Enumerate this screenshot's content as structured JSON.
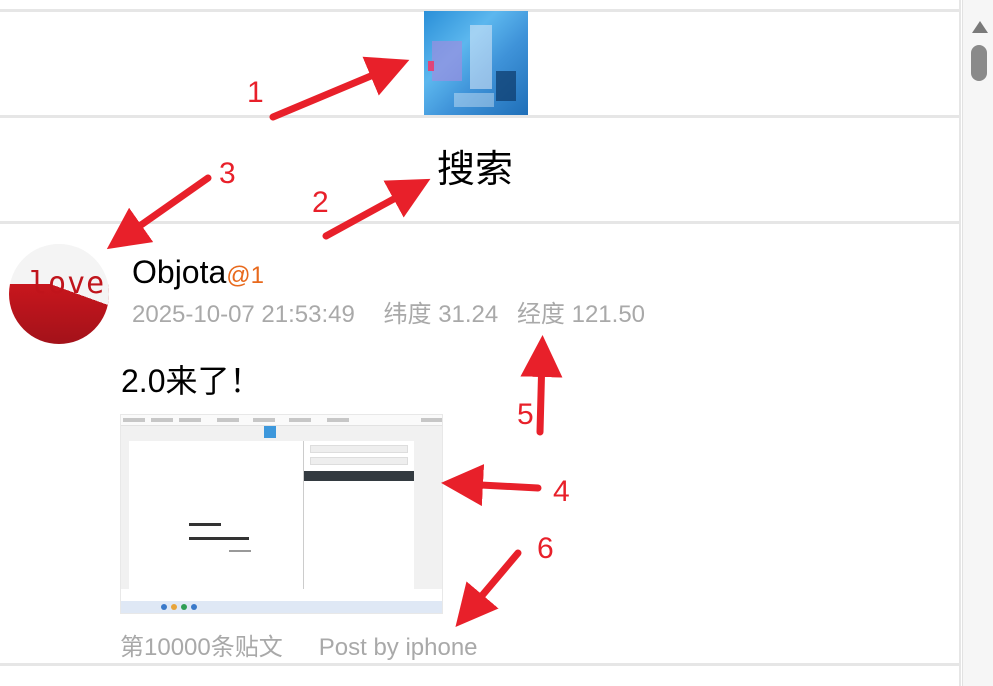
{
  "banner": {
    "image_alt": "blue abstract banner image"
  },
  "search": {
    "title": "搜索"
  },
  "post": {
    "avatar_text": "love",
    "username": "Objota",
    "mention": "@1",
    "timestamp": "2025-10-07 21:53:49",
    "latitude": "纬度 31.24",
    "longitude": "经度 121.50",
    "text": "2.0来了！",
    "post_index": "第10000条贴文",
    "device": "Post by iphone"
  },
  "annotations": [
    "1",
    "2",
    "3",
    "4",
    "5",
    "6"
  ],
  "colors": {
    "annotation": "#e8202a",
    "mention": "#e8691c",
    "meta": "#a9a9a9",
    "divider": "#e6e6e6"
  }
}
